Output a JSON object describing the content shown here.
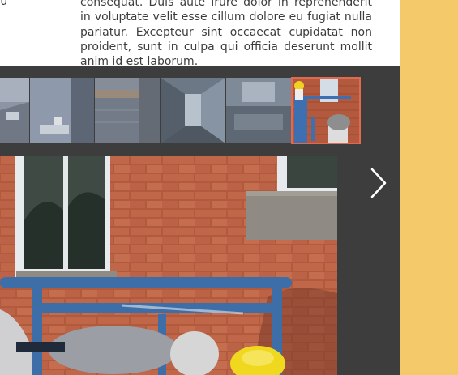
{
  "text_section": {
    "side_label": "Tu",
    "paragraph": "consequat. Duis aute irure dolor in reprehenderit in voluptate velit esse cillum dolore eu fugiat nulla pariatur. Excepteur sint occaecat cupidatat non proident, sunt in culpa qui officia deserunt mollit anim id est laborum."
  },
  "gallery": {
    "thumbnails": [
      {
        "subject": "empty room",
        "active": false
      },
      {
        "subject": "room with sink",
        "active": false
      },
      {
        "subject": "shower wall tiles",
        "active": false
      },
      {
        "subject": "hallway under construction",
        "active": false
      },
      {
        "subject": "worker on scissor lift",
        "active": true
      }
    ],
    "next_icon": "chevron-right-icon",
    "active_border_color": "#e06a4f"
  },
  "main_image": {
    "subject": "workers on blue scissor lift beside red brick wall with windows"
  },
  "colors": {
    "accent_bg": "#f4c96a",
    "dark_bg": "#3d3d3d"
  }
}
